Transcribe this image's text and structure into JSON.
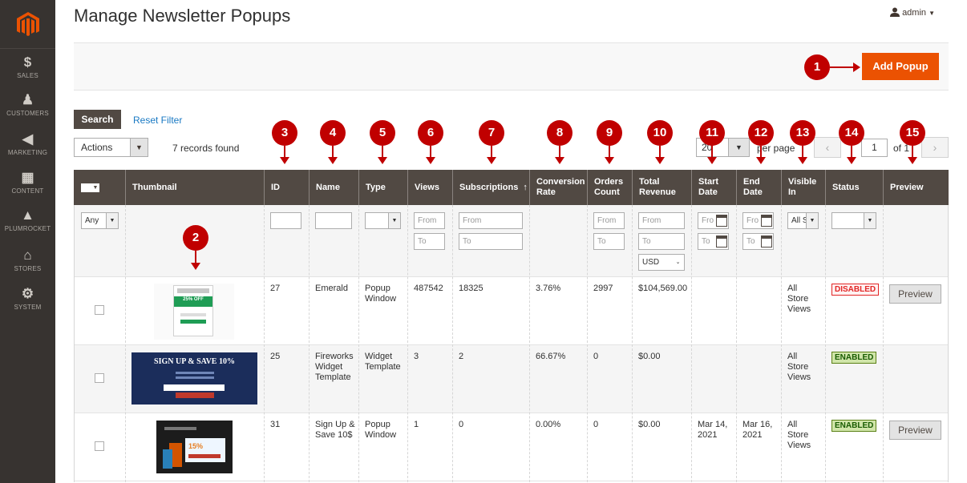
{
  "sidebar": {
    "items": [
      {
        "label": "SALES",
        "icon": "dollar-icon",
        "glyph": "$"
      },
      {
        "label": "CUSTOMERS",
        "icon": "person-icon",
        "glyph": "♟"
      },
      {
        "label": "MARKETING",
        "icon": "megaphone-icon",
        "glyph": "◀"
      },
      {
        "label": "CONTENT",
        "icon": "layout-icon",
        "glyph": "▦"
      },
      {
        "label": "PLUMROCKET",
        "icon": "rocket-icon",
        "glyph": "▲"
      },
      {
        "label": "STORES",
        "icon": "store-icon",
        "glyph": "⌂"
      },
      {
        "label": "SYSTEM",
        "icon": "gear-icon",
        "glyph": "⚙"
      }
    ]
  },
  "header": {
    "title": "Manage Newsletter Popups",
    "user": "admin"
  },
  "toolbar": {
    "add_label": "Add Popup"
  },
  "filters": {
    "search_label": "Search",
    "reset_label": "Reset Filter",
    "actions_label": "Actions",
    "records": "7 records found",
    "per_page_value": "20",
    "per_page_label": "per page",
    "page_value": "1",
    "page_of": "of 1",
    "any": "Any",
    "from": "From",
    "to": "To",
    "from_short": "Fro",
    "to_short": "To",
    "currency": "USD",
    "all_store": "All S"
  },
  "columns": [
    {
      "label": "Thumbnail"
    },
    {
      "label": "ID"
    },
    {
      "label": "Name"
    },
    {
      "label": "Type"
    },
    {
      "label": "Views"
    },
    {
      "label": "Subscriptions",
      "sort": "↑"
    },
    {
      "label": "Conversion Rate"
    },
    {
      "label": "Orders Count"
    },
    {
      "label": "Total Revenue"
    },
    {
      "label": "Start Date"
    },
    {
      "label": "End Date"
    },
    {
      "label": "Visible In"
    },
    {
      "label": "Status"
    },
    {
      "label": "Preview"
    }
  ],
  "rows": [
    {
      "id": "27",
      "name": "Emerald",
      "type": "Popup Window",
      "views": "487542",
      "subs": "18325",
      "conv": "3.76%",
      "orders": "2997",
      "revenue": "$104,569.00",
      "start": "",
      "end": "",
      "visible": "All Store Views",
      "status": "DISABLED",
      "preview": "Preview",
      "thumb_text": "25% OFF"
    },
    {
      "id": "25",
      "name": "Fireworks Widget Template",
      "type": "Widget Template",
      "views": "3",
      "subs": "2",
      "conv": "66.67%",
      "orders": "0",
      "revenue": "$0.00",
      "start": "",
      "end": "",
      "visible": "All Store Views",
      "status": "ENABLED",
      "preview": "",
      "thumb_text": "SIGN UP & SAVE 10%"
    },
    {
      "id": "31",
      "name": "Sign Up & Save 10$",
      "type": "Popup Window",
      "views": "1",
      "subs": "0",
      "conv": "0.00%",
      "orders": "0",
      "revenue": "$0.00",
      "start": "Mar 14, 2021",
      "end": "Mar 16, 2021",
      "visible": "All Store Views",
      "status": "ENABLED",
      "preview": "Preview",
      "thumb_text": "15%"
    }
  ],
  "markers": [
    "1",
    "2",
    "3",
    "4",
    "5",
    "6",
    "7",
    "8",
    "9",
    "10",
    "11",
    "12",
    "13",
    "14",
    "15"
  ],
  "colors": {
    "accent": "#eb5202",
    "marker": "#c00000",
    "header": "#514943",
    "sidebar": "#373330"
  }
}
